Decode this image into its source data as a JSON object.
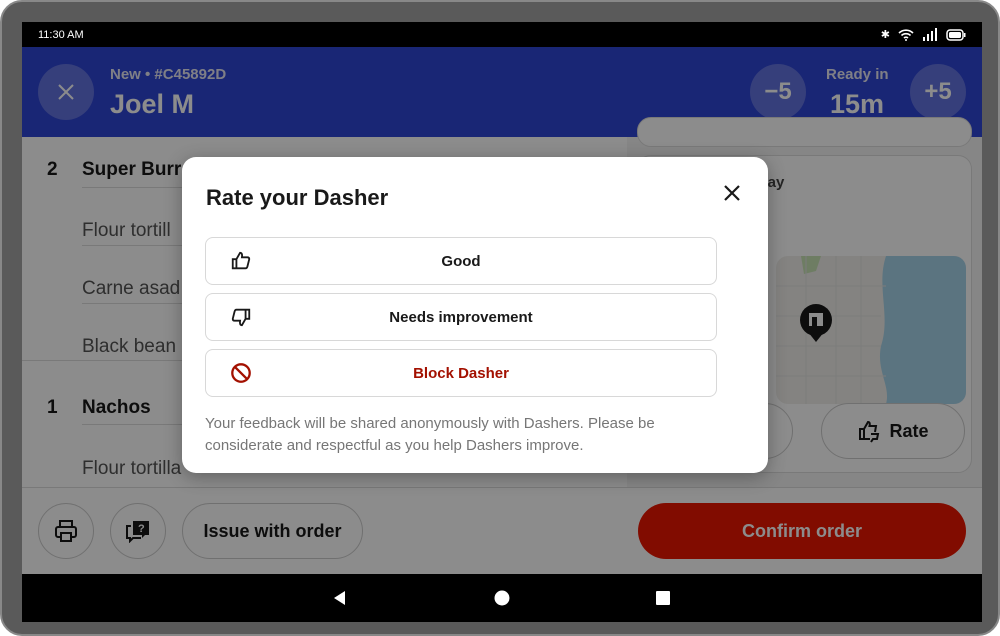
{
  "status_bar": {
    "time": "11:30 AM",
    "icons": [
      "bluetooth-icon",
      "wifi-icon",
      "signal-icon",
      "battery-icon"
    ]
  },
  "header": {
    "subtitle": "New • #C45892D",
    "customer_name": "Joel M",
    "decrease_label": "−5",
    "increase_label": "+5",
    "ready_label": "Ready in",
    "ready_time": "15m",
    "color": "#2f45d6"
  },
  "order_items": [
    {
      "qty": "2",
      "name": "Super Burr",
      "modifiers": [
        "Flour tortill",
        "Carne asad",
        "Black bean"
      ]
    },
    {
      "qty": "1",
      "name": "Nachos",
      "modifiers": [
        "Flour tortilla"
      ]
    }
  ],
  "right_panel": {
    "card_title_fragment": "way",
    "rate_label": "Rate"
  },
  "bottom_bar": {
    "issue_label": "Issue with order",
    "confirm_label": "Confirm order",
    "confirm_color": "#eb1700"
  },
  "modal": {
    "title": "Rate your Dasher",
    "options": [
      {
        "label": "Good",
        "icon": "thumbs-up-icon"
      },
      {
        "label": "Needs improvement",
        "icon": "thumbs-down-icon"
      },
      {
        "label": "Block Dasher",
        "icon": "block-icon",
        "color": "#a31000"
      }
    ],
    "note": "Your feedback will be shared anonymously with Dashers. Please be considerate and respectful as you help Dashers improve."
  }
}
